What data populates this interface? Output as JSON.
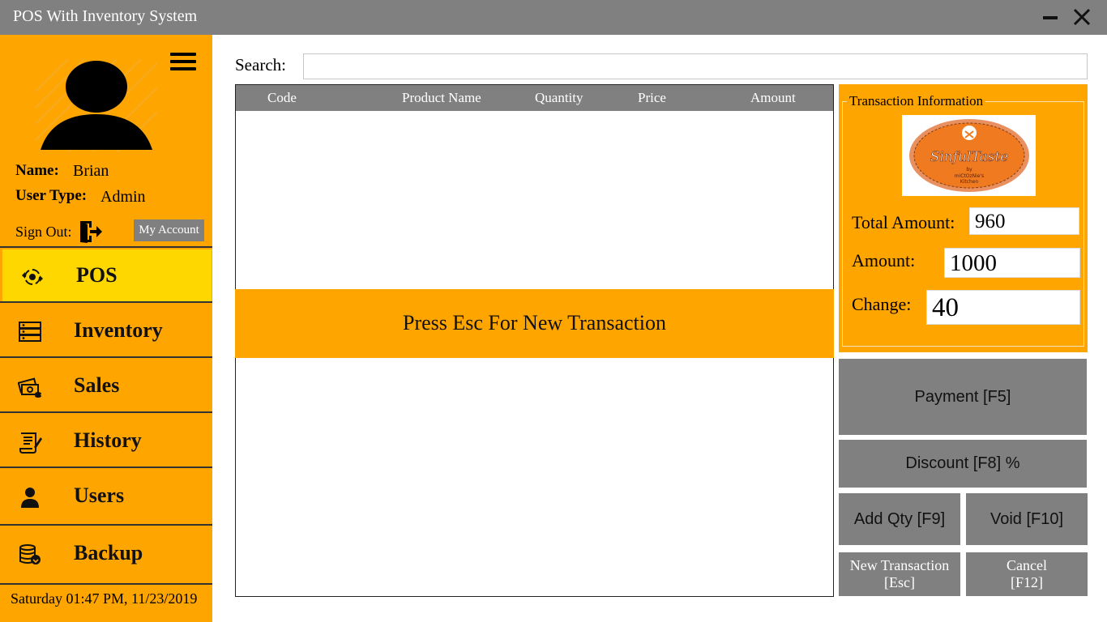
{
  "window": {
    "title": "POS With Inventory System"
  },
  "user": {
    "name_label": "Name:",
    "name": "Brian",
    "type_label": "User Type:",
    "type": "Admin",
    "signout_label": "Sign Out:",
    "my_account_label": "My Account"
  },
  "nav": {
    "items": [
      {
        "label": "POS",
        "icon": "pos-icon",
        "active": true
      },
      {
        "label": "Inventory",
        "icon": "inventory-icon",
        "active": false
      },
      {
        "label": "Sales",
        "icon": "sales-icon",
        "active": false
      },
      {
        "label": "History",
        "icon": "history-icon",
        "active": false
      },
      {
        "label": "Users",
        "icon": "users-icon",
        "active": false
      },
      {
        "label": "Backup",
        "icon": "backup-icon",
        "active": false
      }
    ]
  },
  "datetime": "Saturday 01:47 PM, 11/23/2019",
  "search": {
    "label": "Search:",
    "value": ""
  },
  "grid": {
    "columns": [
      "Code",
      "Product Name",
      "Quantity",
      "Price",
      "Amount"
    ],
    "rows": []
  },
  "banner": "Press Esc For New Transaction",
  "transaction": {
    "title": "Transaction Information",
    "logo": {
      "line1": "SinfulTaste",
      "line2": "by",
      "line3": "miCtOzNie's",
      "line4": "Kitchen"
    },
    "total_label": "Total Amount:",
    "total_value": "960",
    "amount_label": "Amount:",
    "amount_value": "1000",
    "change_label": "Change:",
    "change_value": "40"
  },
  "buttons": {
    "payment": "Payment [F5]",
    "discount": "Discount [F8]  %",
    "add_qty": "Add Qty [F9]",
    "void": "Void [F10]",
    "new_transaction_line1": "New Transaction",
    "new_transaction_line2": "[Esc]",
    "cancel_line1": "Cancel",
    "cancel_line2": "[F12]"
  },
  "colors": {
    "sidebar": "#FFA500",
    "active_nav": "#FFD700",
    "titlebar": "#808080",
    "button": "#808080"
  }
}
